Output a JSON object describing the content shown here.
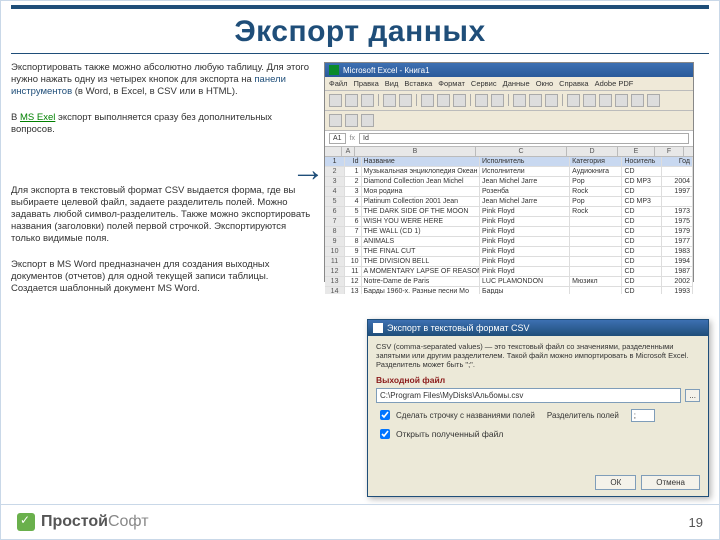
{
  "title": "Экспорт данных",
  "para1_a": "Экспортировать также можно абсолютно любую таблицу. Для этого нужно нажать одну из четырех кнопок для экспорта на ",
  "para1_link": "панели инструментов",
  "para1_b": " (в Word, в Excel, в CSV или в HTML).",
  "para2_a": "В ",
  "para2_link": "MS Exel",
  "para2_b": " экспорт выполняется сразу без дополнительных вопросов.",
  "para3": "Для экспорта в текстовый формат CSV выдается форма, где вы выбираете целевой файл, задаете разделитель полей. Можно задавать любой символ-разделитель. Также можно экспортировать названия (заголовки) полей первой строчкой. Экспортируются только видимые поля.",
  "para4": "Экспорт в MS Word предназначен для создания выходных документов (отчетов) для одной текущей записи таблицы. Создается шаблонный документ MS Word.",
  "excel": {
    "title": "Microsoft Excel - Книга1",
    "menus": [
      "Файл",
      "Правка",
      "Вид",
      "Вставка",
      "Формат",
      "Сервис",
      "Данные",
      "Окно",
      "Справка",
      "Adobe PDF"
    ],
    "cellref": "A1",
    "fxval": "Id",
    "headers": {
      "b": "Название",
      "c": "Исполнитель",
      "d": "Категория",
      "e": "Носитель",
      "f": "Год"
    },
    "rows": [
      {
        "n": "1",
        "a": "Id",
        "b": "Название",
        "c": "Исполнитель",
        "d": "Категория",
        "e": "Носитель",
        "f": "Год"
      },
      {
        "n": "2",
        "a": "1",
        "b": "Музыкальная энциклопедия Океан",
        "c": "Исполнители",
        "d": "Аудиокнига",
        "e": "CD",
        "f": ""
      },
      {
        "n": "3",
        "a": "2",
        "b": "Diamond Collection Jean Michel",
        "c": "Jean Michel Jarre",
        "d": "Pop",
        "e": "CD MP3",
        "f": "2004"
      },
      {
        "n": "4",
        "a": "3",
        "b": "Моя родина",
        "c": "Розенба",
        "d": "Rock",
        "e": "CD",
        "f": "1997"
      },
      {
        "n": "5",
        "a": "4",
        "b": "Platinum Collection 2001 Jean",
        "c": "Jean Michel Jarre",
        "d": "Pop",
        "e": "CD MP3",
        "f": ""
      },
      {
        "n": "6",
        "a": "5",
        "b": "THE DARK SIDE OF THE MOON",
        "c": "Pink Floyd",
        "d": "Rock",
        "e": "CD",
        "f": "1973"
      },
      {
        "n": "7",
        "a": "6",
        "b": "WISH YOU WERE HERE",
        "c": "Pink Floyd",
        "d": "",
        "e": "CD",
        "f": "1975"
      },
      {
        "n": "8",
        "a": "7",
        "b": "THE WALL (CD 1)",
        "c": "Pink Floyd",
        "d": "",
        "e": "CD",
        "f": "1979"
      },
      {
        "n": "9",
        "a": "8",
        "b": "ANIMALS",
        "c": "Pink Floyd",
        "d": "",
        "e": "CD",
        "f": "1977"
      },
      {
        "n": "10",
        "a": "9",
        "b": "THE FINAL CUT",
        "c": "Pink Floyd",
        "d": "",
        "e": "CD",
        "f": "1983"
      },
      {
        "n": "11",
        "a": "10",
        "b": "THE DIVISION BELL",
        "c": "Pink Floyd",
        "d": "",
        "e": "CD",
        "f": "1994"
      },
      {
        "n": "12",
        "a": "11",
        "b": "A MOMENTARY LAPSE OF REASON",
        "c": "Pink Floyd",
        "d": "",
        "e": "CD",
        "f": "1987"
      },
      {
        "n": "13",
        "a": "12",
        "b": "Notre-Dame de Paris",
        "c": "LUC PLAMONDON",
        "d": "Мюзикл",
        "e": "CD",
        "f": "2002"
      },
      {
        "n": "14",
        "a": "13",
        "b": "Барды 1960-х. Разные песни Мо",
        "c": "Барды",
        "d": "",
        "e": "CD",
        "f": "1993"
      }
    ]
  },
  "csv": {
    "title": "Экспорт в текстовый формат CSV",
    "desc": "CSV (comma-separated values) — это текстовый файл со значениями, разделенными запятыми или другим разделителем. Такой файл можно импортировать в Microsoft Excel. Разделитель может быть \";\".",
    "section": "Выходной файл",
    "path": "C:\\Program Files\\MyDisks\\Альбомы.csv",
    "browse": "...",
    "opt_headers": "Сделать строчку с названиями полей",
    "sep_lbl": "Разделитель полей",
    "sep_val": ";",
    "opt_open": "Открыть полученный файл",
    "ok": "ОК",
    "cancel": "Отмена"
  },
  "logo_a": "Простой",
  "logo_b": "Софт",
  "page": "19"
}
